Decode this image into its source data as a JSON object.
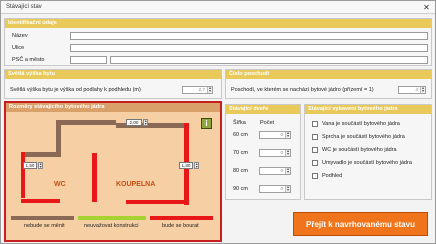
{
  "window": {
    "title": "Stávající stav",
    "close_glyph": "✕"
  },
  "ident": {
    "header": "Identifikační údaje",
    "nazev_label": "Název",
    "ulice_label": "Ulice",
    "psc_label": "PSČ a město",
    "nazev_value": "",
    "ulice_value": "",
    "psc_value": "",
    "mesto_value": ""
  },
  "height": {
    "header": "Světlá výška bytu",
    "question": "Světlá výška bytu je výška od podlahy k podhledu (m)",
    "value": "2,7"
  },
  "floor": {
    "header": "Číslo poschodí",
    "question": "Poschodí, ve kterém se nachází bytové jádro (přízemí = 1)",
    "value": "4"
  },
  "core": {
    "header": "Rozměry stávajícího bytového jádra",
    "info_icon_glyph": "i",
    "dims": {
      "top": "2,00",
      "left": "1,50",
      "right": "1,80"
    },
    "wc_label": "WC",
    "bath_label": "KOUPELNA",
    "legend": [
      {
        "label": "nebude se měnit",
        "color": "#8a6a55"
      },
      {
        "label": "neuvažovat konstrukci",
        "color": "#a6d232"
      },
      {
        "label": "bude se bourat",
        "color": "#e81818"
      }
    ]
  },
  "doors": {
    "header": "Stávající dveře",
    "col_width": "Šířka",
    "col_count": "Počet",
    "rows": [
      {
        "width": "60 cm",
        "count": "0"
      },
      {
        "width": "70 cm",
        "count": "0"
      },
      {
        "width": "80 cm",
        "count": "0"
      },
      {
        "width": "90 cm",
        "count": "0"
      }
    ]
  },
  "equipment": {
    "header": "Stávající vybavení bytového jádra",
    "items": [
      {
        "label": "Vana je součástí bytového jádra",
        "checked": false
      },
      {
        "label": "Sprcha je součástí bytového jádra",
        "checked": false
      },
      {
        "label": "WC je součástí bytového jádra",
        "checked": false
      },
      {
        "label": "Umyvadlo je součástí bytového jádra",
        "checked": false
      },
      {
        "label": "Podhled",
        "checked": false
      }
    ]
  },
  "action": {
    "label": "Přejít k navrhovanému stavu"
  }
}
